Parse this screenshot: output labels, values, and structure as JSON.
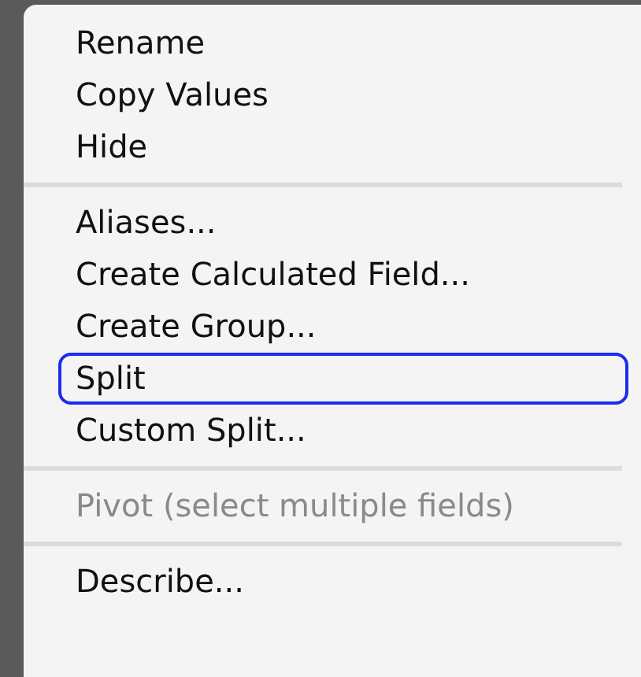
{
  "menu": {
    "sections": [
      {
        "items": [
          {
            "label": "Rename",
            "disabled": false,
            "selected": false
          },
          {
            "label": "Copy Values",
            "disabled": false,
            "selected": false
          },
          {
            "label": "Hide",
            "disabled": false,
            "selected": false
          }
        ]
      },
      {
        "items": [
          {
            "label": "Aliases...",
            "disabled": false,
            "selected": false
          },
          {
            "label": "Create Calculated Field...",
            "disabled": false,
            "selected": false
          },
          {
            "label": "Create Group...",
            "disabled": false,
            "selected": false
          },
          {
            "label": "Split",
            "disabled": false,
            "selected": true
          },
          {
            "label": "Custom Split...",
            "disabled": false,
            "selected": false
          }
        ]
      },
      {
        "items": [
          {
            "label": "Pivot (select multiple fields)",
            "disabled": true,
            "selected": false
          }
        ]
      },
      {
        "items": [
          {
            "label": "Describe...",
            "disabled": false,
            "selected": false
          }
        ]
      }
    ]
  }
}
